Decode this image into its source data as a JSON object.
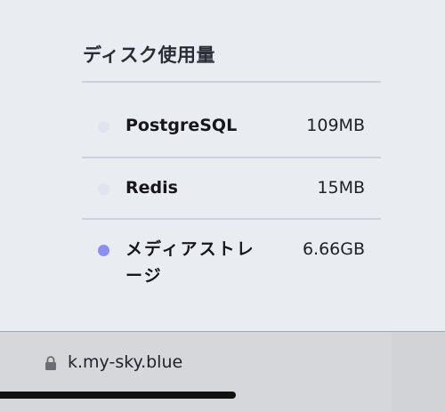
{
  "section": {
    "title": "ディスク使用量"
  },
  "items": [
    {
      "name": "PostgreSQL",
      "size": "109MB",
      "dot_color": "#e1e3ee"
    },
    {
      "name": "Redis",
      "size": "15MB",
      "dot_color": "#e1e3ee"
    },
    {
      "name": "メディアストレージ",
      "size": "6.66GB",
      "dot_color": "#8b8ef3"
    }
  ],
  "browser": {
    "url": "k.my-sky.blue",
    "lock_icon": "lock-icon"
  }
}
